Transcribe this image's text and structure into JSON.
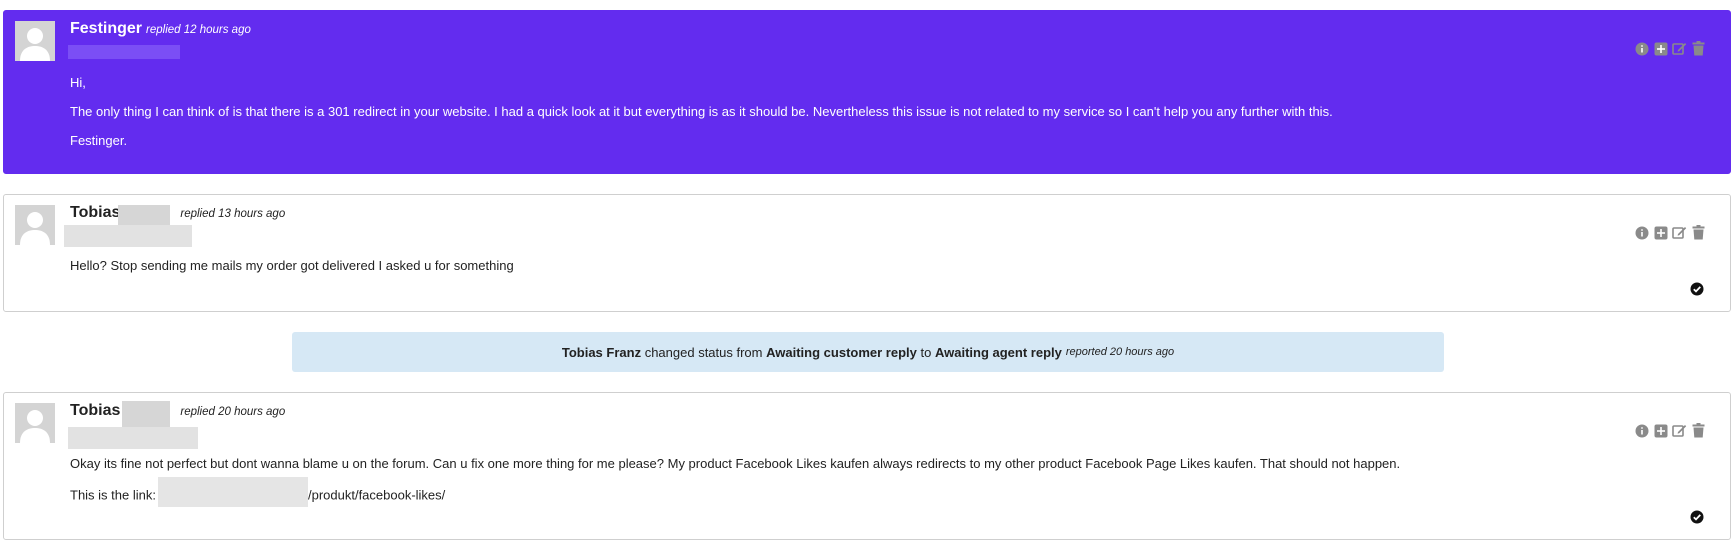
{
  "colors": {
    "agent_bg": "#632cef",
    "status_bg": "#d6e8f5"
  },
  "replies": [
    {
      "author": "Festinger",
      "meta": "replied 12 hours ago",
      "paragraphs": [
        "Hi,",
        "The only thing I can think of is that there is a 301 redirect in your website. I had a quick look at it but everything is as it should be. Nevertheless this issue is not related to my service so I can't help you any further with this.",
        "Festinger."
      ]
    },
    {
      "author": "Tobias",
      "meta": "replied 13 hours ago",
      "paragraphs": [
        "Hello? Stop sending me mails my order got delivered I asked u for something"
      ]
    },
    {
      "author": "Tobias",
      "meta": "replied 20 hours ago",
      "paragraphs": [
        "Okay its fine not perfect but dont wanna blame u on the forum. Can u fix one more thing for me please? My product Facebook Likes kaufen always redirects to my other product Facebook Page Likes kaufen. That should not happen.",
        "This is the link:"
      ],
      "link_suffix": "/produkt/facebook-likes/"
    }
  ],
  "status_change": {
    "actor": "Tobias Franz",
    "changed_text": "changed status from",
    "from": "Awaiting customer reply",
    "to_word": "to",
    "to": "Awaiting agent reply",
    "meta": "reported 20 hours ago"
  },
  "actions": [
    "info-icon",
    "plus-square-icon",
    "edit-icon",
    "trash-icon"
  ]
}
